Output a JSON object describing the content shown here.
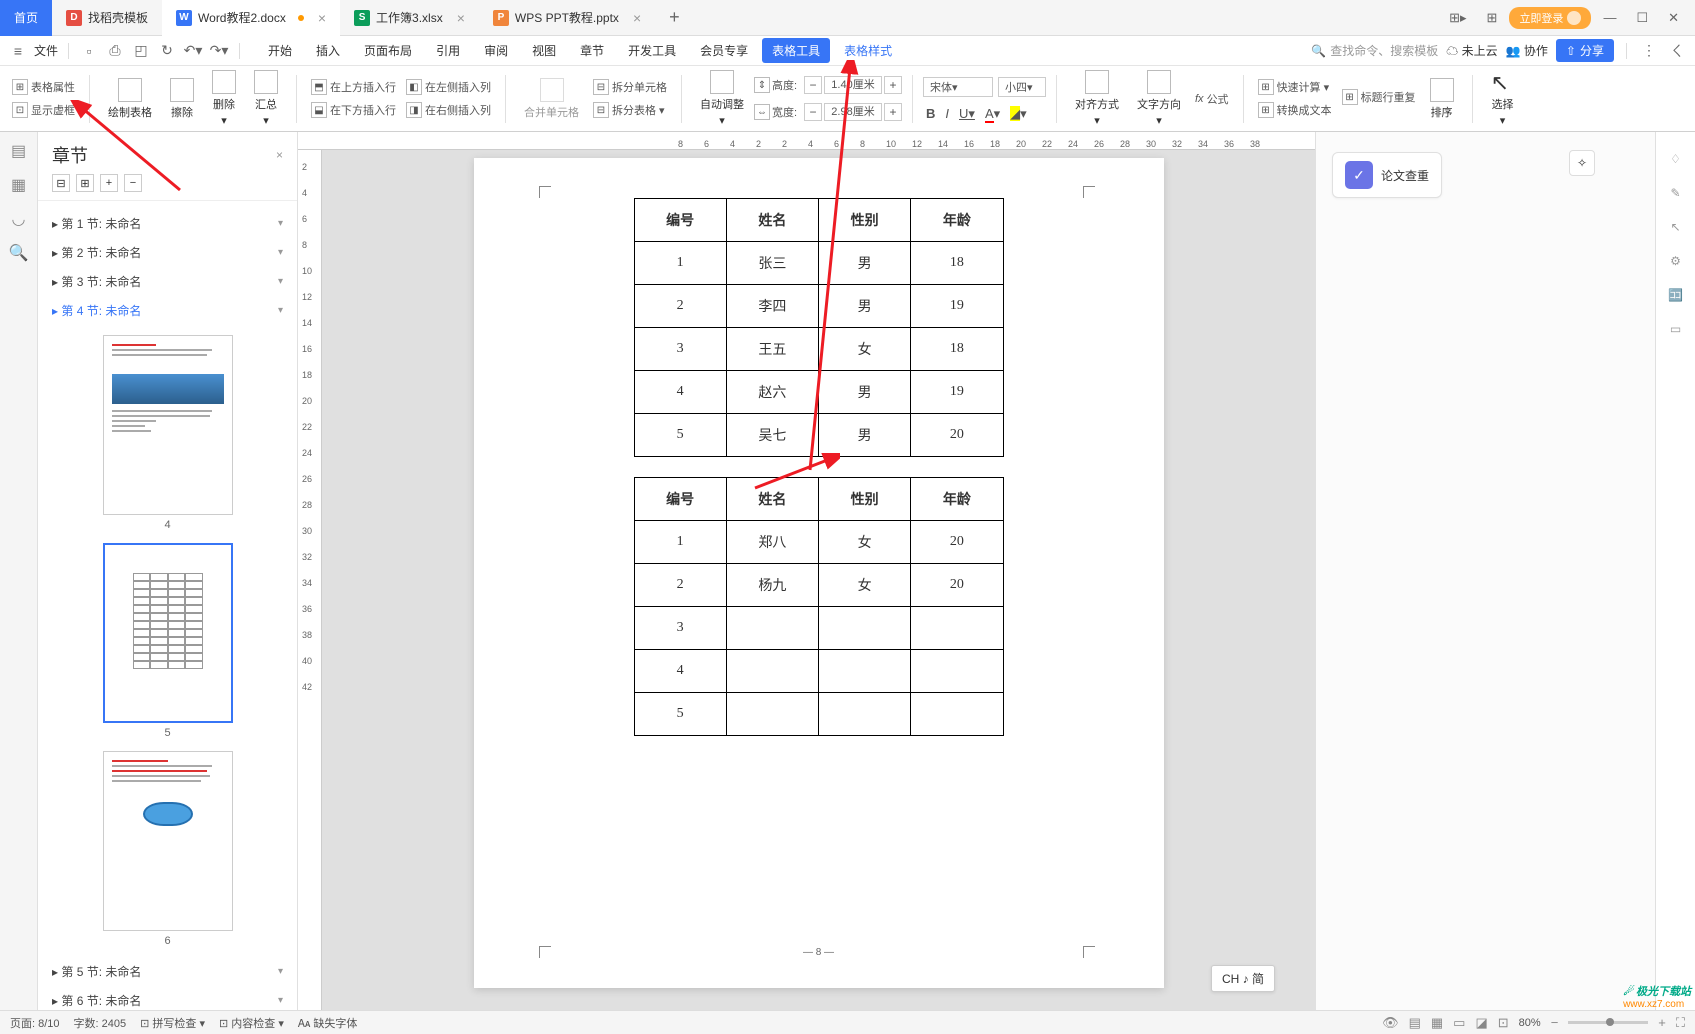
{
  "tabs": {
    "home": "首页",
    "t1": "找稻壳模板",
    "t2": "Word教程2.docx",
    "t3": "工作簿3.xlsx",
    "t4": "WPS PPT教程.pptx"
  },
  "wincontrols": {
    "login": "立即登录"
  },
  "file_label": "文件",
  "menu": {
    "start": "开始",
    "insert": "插入",
    "layout": "页面布局",
    "ref": "引用",
    "review": "审阅",
    "view": "视图",
    "section": "章节",
    "dev": "开发工具",
    "member": "会员专享",
    "tabletool": "表格工具",
    "tablestyle": "表格样式"
  },
  "search": {
    "placeholder": "查找命令、搜索模板"
  },
  "cloud": "未上云",
  "collab": "协作",
  "share": "分享",
  "ribbon": {
    "tableprops": "表格属性",
    "showborder": "显示虚框",
    "drawtable": "绘制表格",
    "erase": "擦除",
    "delete": "删除",
    "summary": "汇总",
    "insabove": "在上方插入行",
    "insbelow": "在下方插入行",
    "insleft": "在左侧插入列",
    "insright": "在右侧插入列",
    "mergecell": "合并单元格",
    "splitcell": "拆分单元格",
    "splittable": "拆分表格",
    "autofit": "自动调整",
    "height": "高度:",
    "width": "宽度:",
    "hval": "1.40厘米",
    "wval": "2.98厘米",
    "font": "宋体",
    "size": "小四",
    "align": "对齐方式",
    "textdir": "文字方向",
    "formula": "公式",
    "fx": "fx",
    "quickcalc": "快速计算",
    "titlerepeat": "标题行重复",
    "totext": "转换成文本",
    "sort": "排序",
    "select": "选择"
  },
  "panel": {
    "title": "章节",
    "items": [
      "第 1 节: 未命名",
      "第 2 节: 未命名",
      "第 3 节: 未命名",
      "第 4 节: 未命名",
      "第 5 节: 未命名",
      "第 6 节: 未命名"
    ],
    "thumbs": [
      "4",
      "5",
      "6"
    ]
  },
  "document": {
    "headers": [
      "编号",
      "姓名",
      "性别",
      "年龄"
    ],
    "table1": [
      [
        "1",
        "张三",
        "男",
        "18"
      ],
      [
        "2",
        "李四",
        "男",
        "19"
      ],
      [
        "3",
        "王五",
        "女",
        "18"
      ],
      [
        "4",
        "赵六",
        "男",
        "19"
      ],
      [
        "5",
        "吴七",
        "男",
        "20"
      ]
    ],
    "table2": [
      [
        "1",
        "郑八",
        "女",
        "20"
      ],
      [
        "2",
        "杨九",
        "女",
        "20"
      ],
      [
        "3",
        "",
        "",
        ""
      ],
      [
        "4",
        "",
        "",
        ""
      ],
      [
        "5",
        "",
        "",
        ""
      ]
    ],
    "pagenum": "— 8 —"
  },
  "rr": {
    "essay": "论文查重"
  },
  "ime": "CH ♪ 简",
  "status": {
    "pages": "页面: 8/10",
    "words": "字数: 2405",
    "spell": "拼写检查",
    "content": "内容检查",
    "missingfont": "缺失字体",
    "zoom": "80%"
  },
  "ruler_h": [
    "8",
    "6",
    "4",
    "2",
    "2",
    "4",
    "6",
    "8",
    "10",
    "12",
    "14",
    "16",
    "18",
    "20",
    "22",
    "24",
    "26",
    "28",
    "30",
    "32",
    "34",
    "36",
    "38"
  ],
  "ruler_v": [
    "2",
    "4",
    "6",
    "8",
    "10",
    "12",
    "14",
    "16",
    "18",
    "20",
    "22",
    "24",
    "26",
    "28",
    "30",
    "32",
    "34",
    "36",
    "38",
    "40",
    "42"
  ],
  "watermark": {
    "l1": "极光下载站",
    "l2": "www.xz7.com"
  }
}
